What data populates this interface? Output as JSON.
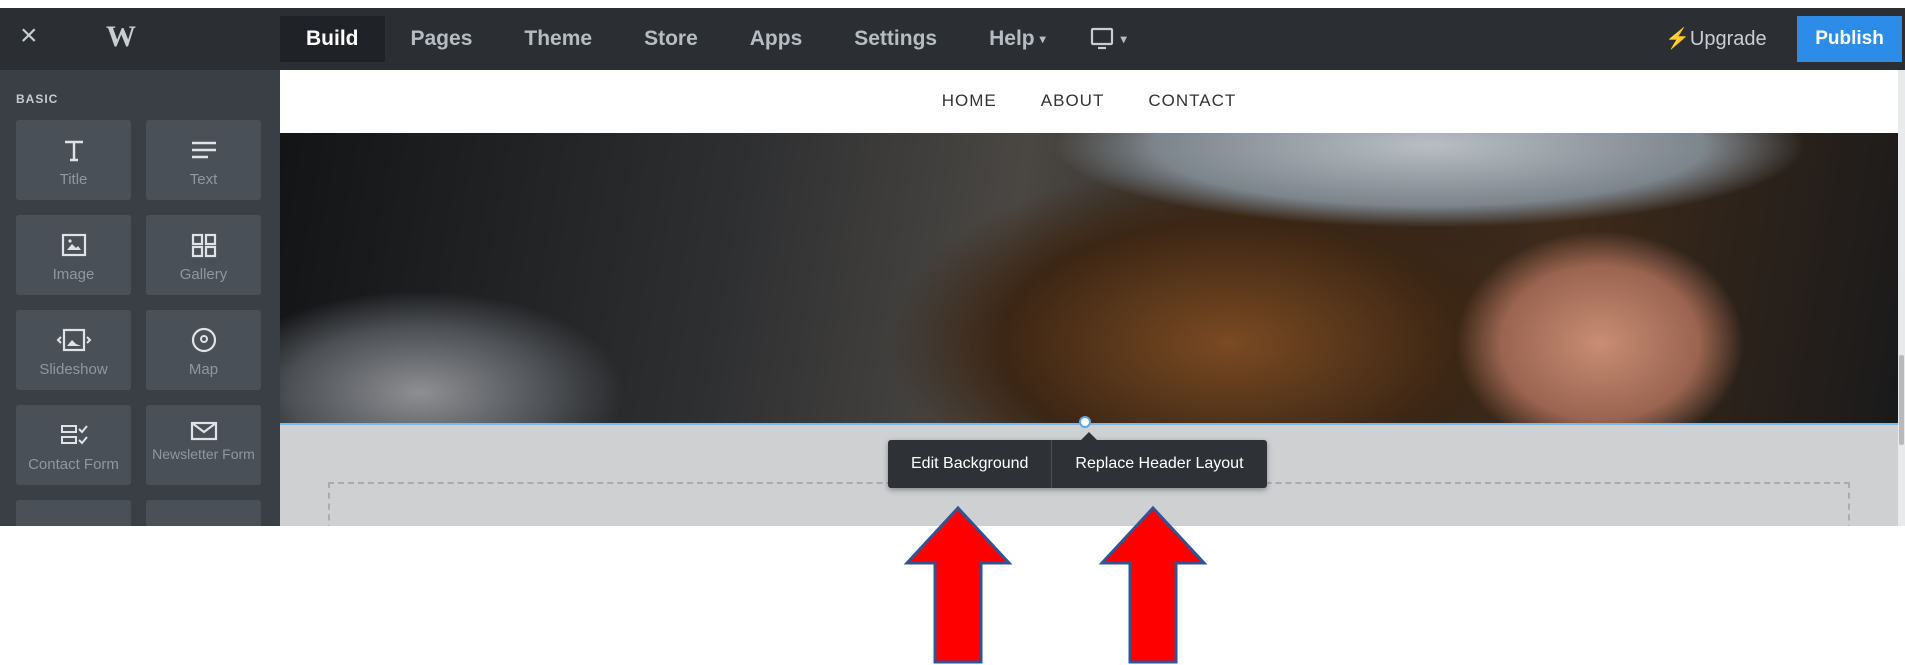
{
  "topbar": {
    "tabs": [
      "Build",
      "Pages",
      "Theme",
      "Store",
      "Apps",
      "Settings",
      "Help"
    ],
    "upgrade_label": "Upgrade",
    "publish_label": "Publish"
  },
  "sidebar": {
    "section_label": "BASIC",
    "items": [
      {
        "label": "Title",
        "icon": "title-icon"
      },
      {
        "label": "Text",
        "icon": "text-icon"
      },
      {
        "label": "Image",
        "icon": "image-icon"
      },
      {
        "label": "Gallery",
        "icon": "gallery-icon"
      },
      {
        "label": "Slideshow",
        "icon": "slideshow-icon"
      },
      {
        "label": "Map",
        "icon": "map-icon"
      },
      {
        "label": "Contact Form",
        "icon": "contact-form-icon"
      },
      {
        "label": "Newsletter Form",
        "icon": "newsletter-form-icon"
      }
    ]
  },
  "site": {
    "nav": [
      "HOME",
      "ABOUT",
      "CONTACT"
    ]
  },
  "popover": {
    "edit_background": "Edit Background",
    "replace_header": "Replace Header Layout"
  },
  "colors": {
    "topbar_bg": "#2b2f33",
    "publish_bg": "#2d8ce8",
    "annotation_arrow": "#ff0000",
    "annotation_outline": "#2f5597"
  }
}
